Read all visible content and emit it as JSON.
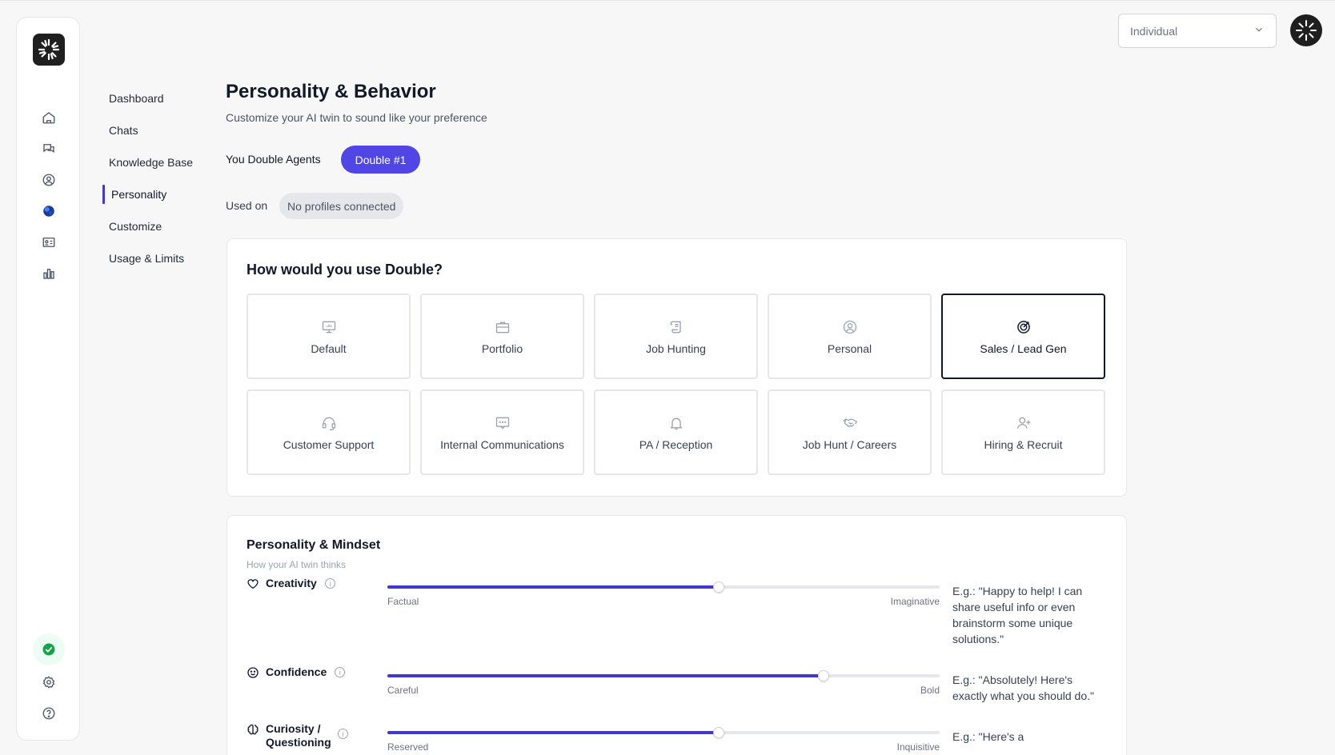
{
  "account_select": {
    "value": "Individual"
  },
  "subnav": {
    "items": [
      {
        "label": "Dashboard"
      },
      {
        "label": "Chats"
      },
      {
        "label": "Knowledge Base"
      },
      {
        "label": "Personality"
      },
      {
        "label": "Customize"
      },
      {
        "label": "Usage & Limits"
      }
    ],
    "active": "Personality"
  },
  "header": {
    "title": "Personality & Behavior",
    "subtitle": "Customize your AI twin to sound like your preference",
    "agents_label": "You Double Agents",
    "agent_pill": "Double #1",
    "used_on_label": "Used on",
    "used_on_value": "No profiles connected"
  },
  "use_card": {
    "title": "How would you use Double?",
    "tiles": [
      {
        "label": "Default",
        "icon": "presentation-icon"
      },
      {
        "label": "Portfolio",
        "icon": "briefcase-icon"
      },
      {
        "label": "Job Hunting",
        "icon": "scroll-icon"
      },
      {
        "label": "Personal",
        "icon": "user-circle-icon"
      },
      {
        "label": "Sales / Lead Gen",
        "icon": "target-icon"
      },
      {
        "label": "Customer Support",
        "icon": "headset-icon"
      },
      {
        "label": "Internal Communications",
        "icon": "message-icon"
      },
      {
        "label": "PA / Reception",
        "icon": "bell-icon"
      },
      {
        "label": "Job Hunt / Careers",
        "icon": "handshake-icon"
      },
      {
        "label": "Hiring & Recruit",
        "icon": "user-plus-icon"
      }
    ],
    "selected": "Sales / Lead Gen"
  },
  "personality_card": {
    "title": "Personality & Mindset",
    "subtitle": "How your AI twin thinks",
    "traits": [
      {
        "name": "Creativity",
        "icon": "heart-icon",
        "min_label": "Factual",
        "max_label": "Imaginative",
        "value": 0.6,
        "example": "E.g.: \"Happy to help! I can share useful info or even brainstorm some unique solutions.\""
      },
      {
        "name": "Confidence",
        "icon": "smile-icon",
        "min_label": "Careful",
        "max_label": "Bold",
        "value": 0.79,
        "example": "E.g.: \"Absolutely! Here's exactly what you should do.\""
      },
      {
        "name": "Curiosity / Questioning",
        "icon": "brain-icon",
        "min_label": "Reserved",
        "max_label": "Inquisitive",
        "value": 0.6,
        "example": "E.g.: \"Here's a"
      }
    ]
  },
  "colors": {
    "accent": "#4f46e5",
    "slider_fill": "#4338ca",
    "verified": "#16a34a"
  }
}
